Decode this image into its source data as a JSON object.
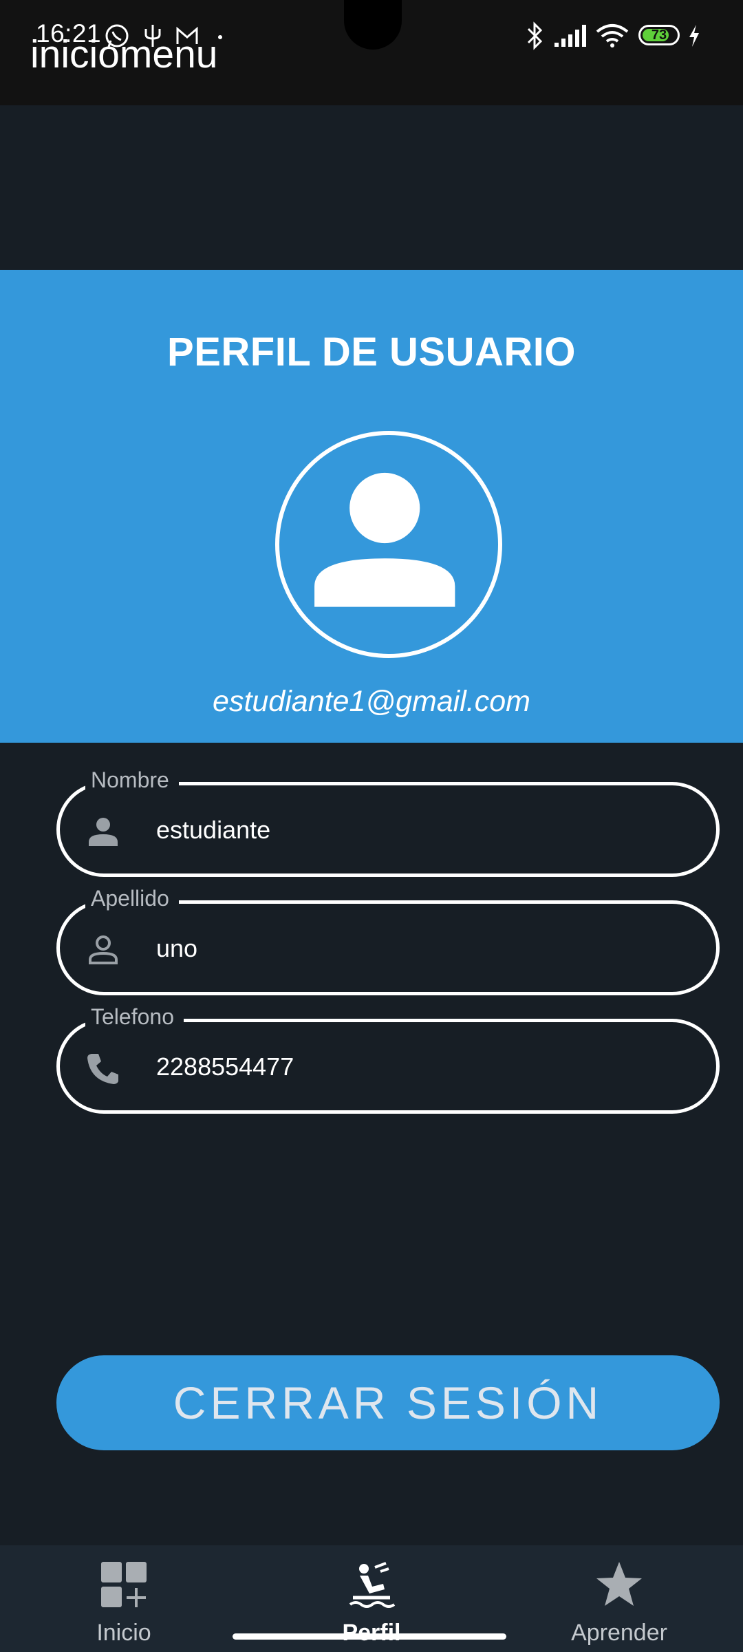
{
  "status_bar": {
    "time": "16:21",
    "battery_level": "73",
    "icons": [
      "whatsapp-icon",
      "usb-icon",
      "gmail-icon",
      "dot-icon",
      "bluetooth-icon",
      "signal-icon",
      "wifi-icon",
      "battery-icon",
      "charging-icon"
    ]
  },
  "app_bar": {
    "title": "iniciomenu"
  },
  "profile": {
    "title": "PERFIL DE USUARIO",
    "email": "estudiante1@gmail.com",
    "avatar_icon": "person-icon"
  },
  "form": {
    "fields": [
      {
        "label": "Nombre",
        "value": "estudiante",
        "icon": "person-filled-icon"
      },
      {
        "label": "Apellido",
        "value": "uno",
        "icon": "person-outline-icon"
      },
      {
        "label": "Telefono",
        "value": "2288554477",
        "icon": "phone-icon"
      }
    ]
  },
  "logout_button": {
    "label": "CERRAR SESIÓN"
  },
  "bottom_nav": {
    "items": [
      {
        "label": "Inicio",
        "icon": "dashboard-add-icon",
        "active": false
      },
      {
        "label": "Perfil",
        "icon": "kitesurfing-icon",
        "active": true
      },
      {
        "label": "Aprender",
        "icon": "star-icon",
        "active": false
      }
    ]
  },
  "colors": {
    "background": "#171e25",
    "accent": "#3498db",
    "status_bar": "#121212",
    "bottom_nav": "#1d2731"
  }
}
